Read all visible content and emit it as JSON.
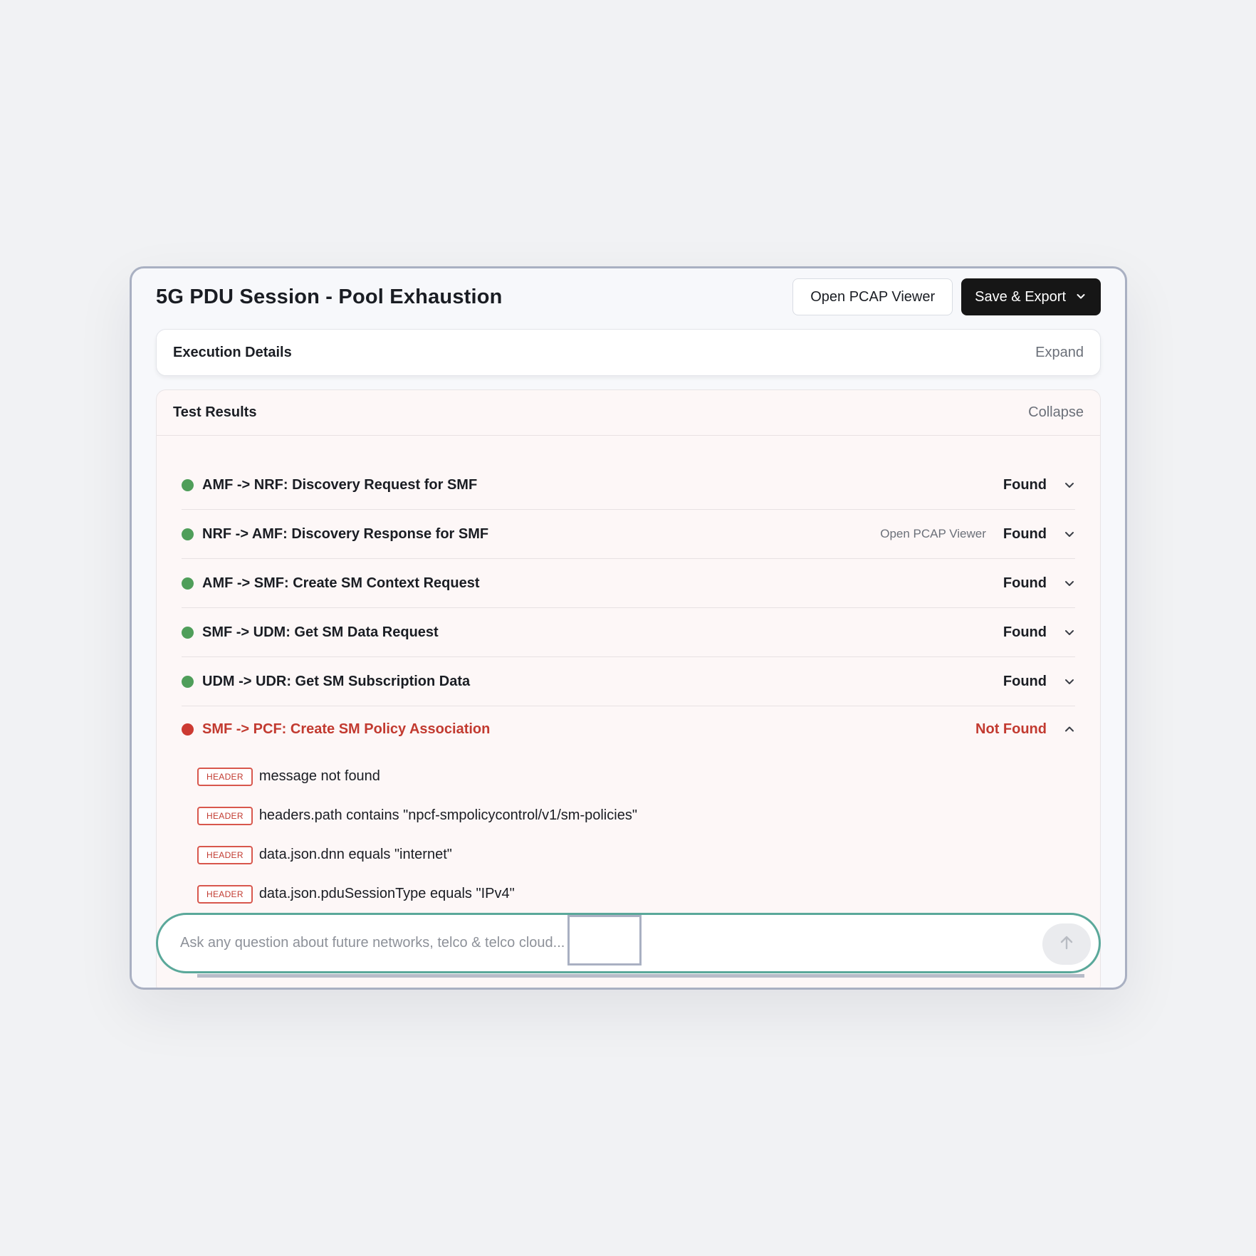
{
  "header": {
    "title": "5G PDU Session - Pool Exhaustion",
    "open_pcap_label": "Open PCAP Viewer",
    "save_export_label": "Save & Export"
  },
  "execution_details": {
    "title": "Execution Details",
    "toggle": "Expand"
  },
  "test_results": {
    "title": "Test Results",
    "toggle": "Collapse",
    "rows": [
      {
        "label": "AMF -> NRF: Discovery Request for SMF",
        "status": "Found",
        "action": ""
      },
      {
        "label": "NRF -> AMF: Discovery Response for SMF",
        "status": "Found",
        "action": "Open PCAP Viewer"
      },
      {
        "label": "AMF -> SMF: Create SM Context Request",
        "status": "Found",
        "action": ""
      },
      {
        "label": "SMF -> UDM: Get SM Data Request",
        "status": "Found",
        "action": ""
      },
      {
        "label": "UDM -> UDR: Get SM Subscription Data",
        "status": "Found",
        "action": ""
      },
      {
        "label": "SMF -> PCF: Create SM Policy Association",
        "status": "Not Found",
        "action": ""
      }
    ],
    "conditions": [
      {
        "tag": "HEADER",
        "text": "message not found"
      },
      {
        "tag": "HEADER",
        "text": "headers.path contains \"npcf-smpolicycontrol/v1/sm-policies\""
      },
      {
        "tag": "HEADER",
        "text": "data.json.dnn equals \"internet\""
      },
      {
        "tag": "HEADER",
        "text": "data.json.pduSessionType equals \"IPv4\""
      }
    ]
  },
  "chat": {
    "placeholder": "Ask any question about future networks, telco & telco cloud...",
    "value": ""
  },
  "colors": {
    "found": "#4f9e5a",
    "not_found": "#c23a30",
    "chat_border": "#5aa89a",
    "dark_button": "#161616"
  },
  "icons": {
    "row_expand": "chevron-down-icon",
    "row_collapse": "chevron-up-icon",
    "save_menu": "chevron-down-icon",
    "send": "arrow-up-icon"
  }
}
